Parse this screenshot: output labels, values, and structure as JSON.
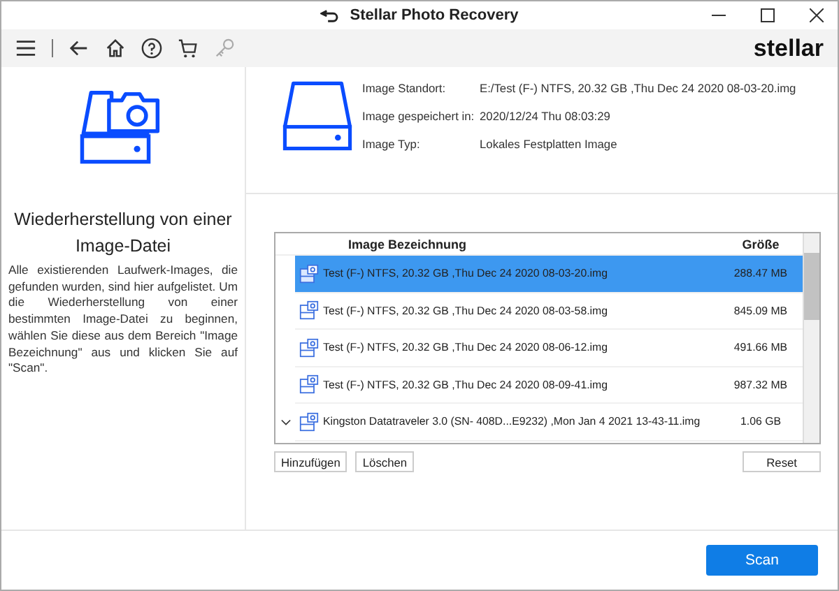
{
  "window": {
    "title": "Stellar Photo Recovery"
  },
  "toolbar": {
    "logo": "stellar"
  },
  "sidebar": {
    "heading": "Wiederherstellung von einer Image-Datei",
    "description": "Alle existierenden Laufwerk-Images, die gefunden wurden, sind hier aufgelistet. Um die Wiederherstellung von einer bestimmten Image-Datei zu beginnen, wählen Sie diese aus dem Bereich \"Image Bezeichnung\" aus und klicken Sie auf \"Scan\"."
  },
  "details": [
    {
      "label": "Image Standort:",
      "value": "E:/Test (F-) NTFS, 20.32 GB ,Thu Dec 24 2020 08-03-20.img"
    },
    {
      "label": "Image gespeichert in:",
      "value": "2020/12/24 Thu 08:03:29"
    },
    {
      "label": "Image Typ:",
      "value": "Lokales Festplatten Image"
    }
  ],
  "table": {
    "columns": [
      "Image Bezeichnung",
      "Größe"
    ],
    "rows": [
      {
        "kind": "image",
        "name": "Test (F-) NTFS, 20.32 GB ,Thu Dec 24 2020 08-03-20.img",
        "size": "288.47 MB",
        "selected": true
      },
      {
        "kind": "image",
        "name": "Test (F-) NTFS, 20.32 GB ,Thu Dec 24 2020 08-03-58.img",
        "size": "845.09 MB",
        "selected": false
      },
      {
        "kind": "image",
        "name": "Test (F-) NTFS, 20.32 GB ,Thu Dec 24 2020 08-06-12.img",
        "size": "491.66 MB",
        "selected": false
      },
      {
        "kind": "image",
        "name": "Test (F-) NTFS, 20.32 GB ,Thu Dec 24 2020 08-09-41.img",
        "size": "987.32 MB",
        "selected": false
      },
      {
        "kind": "group",
        "name": "Kingston Datatraveler 3.0 (SN- 408D...E9232) ,Mon Jan 4 2021 13-43-11.img",
        "size": "1.06 GB",
        "selected": false
      }
    ]
  },
  "buttons": {
    "add": "Hinzufügen",
    "delete": "Löschen",
    "reset": "Reset",
    "scan": "Scan"
  }
}
